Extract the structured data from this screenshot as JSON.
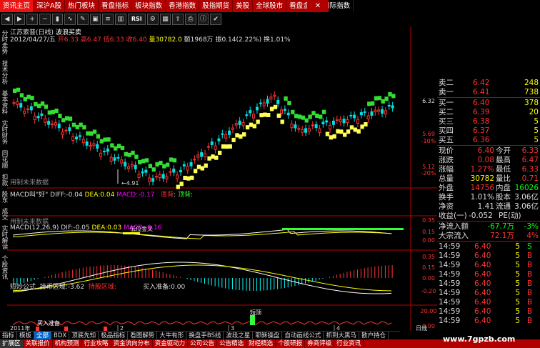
{
  "top_menu": [
    "资讯主页",
    "深沪A股",
    "热门板块",
    "看盘指标",
    "板块指数",
    "香港指数",
    "股指期货",
    "美股",
    "全球股市",
    "看盘金属",
    "国际指数"
  ],
  "toolbar_icons": [
    "RSI"
  ],
  "left_tabs": [
    "分时走势",
    "技术分析",
    "基本资料",
    "实时财务",
    "同花顺",
    "扣款",
    "股东",
    "成交",
    "实时解读",
    "个股资讯"
  ],
  "header": {
    "stock": "江苏索普(日线)",
    "indicator": "波浪买卖",
    "date": "2012/04/27/五",
    "open_label": "开",
    "open": "6.33",
    "high_label": "高",
    "high": "6.47",
    "low_label": "低",
    "low": "6.33",
    "close_label": "收",
    "close": "6.40",
    "vol_label": "量",
    "vol": "30782.0",
    "amount_label": "额",
    "amount": "1968万",
    "amp_label": "振",
    "amp": "0.14(2.22%)",
    "turnover_label": "换",
    "turnover": "1.01%"
  },
  "price_axis": {
    "ticks": [
      "6.32",
      "5.69",
      "-10%",
      "5.12",
      "-20%"
    ],
    "low_marker": "4.91",
    "subchart_label": "用制未来数据"
  },
  "macd_panel1": {
    "title": "MACD叫\"好\"",
    "diff_label": "DIFF:",
    "diff": "-0.04",
    "dea_label": "DEA:",
    "dea": "0.04",
    "macd_label": "MACD:",
    "macd": "-0.17",
    "red_label": "底背",
    "green_label": "顶背",
    "cross_label": "低位金叉",
    "ticks": [
      "0.35",
      "0.15",
      "0.00"
    ],
    "subchart_label": "用制未来数据"
  },
  "macd_panel2": {
    "title": "MACD(12,26,9)",
    "diff_label": "DIF:",
    "diff": "-0.05",
    "dea_label": "DEA:",
    "dea": "0.03",
    "macd_label": "MACD:",
    "macd": "-0.16",
    "ticks": [
      "0.35",
      "0.15",
      "0.00",
      "-0.20"
    ]
  },
  "short_panel": {
    "title": "短炒公式",
    "hold_label": "持币区域:",
    "hold": "-3.62",
    "hold_label2": "持股区域:",
    "buy_prep_label": "买入准备:",
    "buy_prep": "0.00",
    "buy_mark": "买入准备",
    "top_mark": "短顶",
    "ticks": [
      "20.00",
      "0.00"
    ]
  },
  "x_axis": {
    "year": "2011年",
    "months": [
      "2",
      "3",
      "4"
    ],
    "cycle": "日线"
  },
  "quotes": {
    "sell": [
      {
        "label": "卖二",
        "price": "6.42",
        "vol": "248"
      },
      {
        "label": "卖一",
        "price": "6.41",
        "vol": "738"
      }
    ],
    "buy": [
      {
        "label": "买一",
        "price": "6.40",
        "vol": "378"
      },
      {
        "label": "买二",
        "price": "6.39",
        "vol": "20"
      },
      {
        "label": "买三",
        "price": "6.38",
        "vol": "5"
      },
      {
        "label": "买四",
        "price": "6.37",
        "vol": "5"
      },
      {
        "label": "买五",
        "price": "6.36",
        "vol": "5"
      }
    ]
  },
  "stats": [
    {
      "l1": "现价",
      "v1": "6.40",
      "l2": "今开",
      "v2": "6.33"
    },
    {
      "l1": "涨跌",
      "v1": "0.08",
      "l2": "最高",
      "v2": "6.47"
    },
    {
      "l1": "涨幅",
      "v1": "1.27%",
      "l2": "最低",
      "v2": "6.33"
    },
    {
      "l1": "总量",
      "v1": "30782",
      "l2": "量比",
      "v2": "0.71"
    },
    {
      "l1": "外盘",
      "v1": "14756",
      "l2": "内盘",
      "v2": "16026"
    },
    {
      "l1": "换手",
      "v1": "1.01%",
      "l2": "股本",
      "v2": "3.06亿"
    },
    {
      "l1": "净资",
      "v1": "1.41",
      "l2": "流通",
      "v2": "3.06亿"
    }
  ],
  "earnings": {
    "label": "收益(一)",
    "value": "-0.052",
    "pe_label": "PE(动)",
    "pe": ""
  },
  "flows": [
    {
      "label": "净流入额",
      "value": "-67.7万",
      "pct": "-3%"
    },
    {
      "label": "大宗流入",
      "value": "72.1万",
      "pct": "4%"
    }
  ],
  "ticks_list": [
    {
      "time": "14:59",
      "price": "6.40",
      "vol": "5",
      "side": "S"
    },
    {
      "time": "14:59",
      "price": "6.40",
      "vol": "5",
      "side": "B"
    },
    {
      "time": "14:59",
      "price": "6.40",
      "vol": "5",
      "side": "B"
    },
    {
      "time": "14:59",
      "price": "6.40",
      "vol": "5",
      "side": "B"
    },
    {
      "time": "14:59",
      "price": "6.40",
      "vol": "5",
      "side": "B"
    },
    {
      "time": "14:59",
      "price": "6.40",
      "vol": "5",
      "side": "B"
    },
    {
      "time": "14:59",
      "price": "6.40",
      "vol": "5",
      "side": "B"
    },
    {
      "time": "14:59",
      "price": "6.40",
      "vol": "5",
      "side": "B"
    },
    {
      "time": "14:59",
      "price": "6.40",
      "vol": "5",
      "side": "B"
    }
  ],
  "bottom_tabs1": [
    "指标",
    "模板",
    "全部",
    "BDX",
    "顶底先知",
    "极品指标",
    "看图解势",
    "大牛有形",
    "换盘手BS线",
    "波段之星",
    "耶稣操盘",
    "自动画线公式",
    "抓到大黑马",
    "散户持仓"
  ],
  "bottom_tabs2": [
    "扩展区",
    "关联报价",
    "机构预测",
    "行业攻略",
    "资金流向分布",
    "资金驱动力",
    "公司公告",
    "公告精选",
    "财经精选",
    "个股研报",
    "券商评级",
    "行业资讯"
  ],
  "watermark": "www.7gpzb.com",
  "colors": {
    "up": "#ff3333",
    "down": "#00e0e0",
    "wave_up": "#ffff55",
    "wave_down": "#33dd33",
    "menu": "#b00000"
  }
}
